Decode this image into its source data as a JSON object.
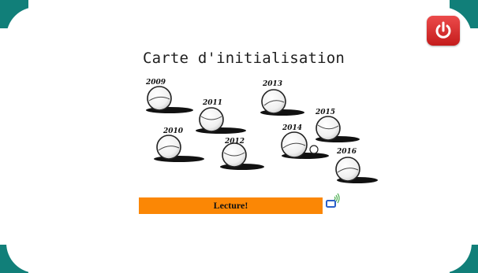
{
  "colors": {
    "frame": "#117f79",
    "background": "#ffffff",
    "power_button": "#d42f2f",
    "read_button": "#fb8705",
    "nfc_card": "#2a5fc8",
    "nfc_waves": "#4caf50"
  },
  "header": {
    "power_icon": "power-icon"
  },
  "main": {
    "title": "Carte d'initialisation",
    "balls": [
      {
        "year": "2009"
      },
      {
        "year": "2011"
      },
      {
        "year": "2013"
      },
      {
        "year": "2015"
      },
      {
        "year": "2010"
      },
      {
        "year": "2012"
      },
      {
        "year": "2014"
      },
      {
        "year": "2016"
      }
    ],
    "read_button_label": "Lecture!",
    "nfc_icon": "nfc-card-icon"
  }
}
